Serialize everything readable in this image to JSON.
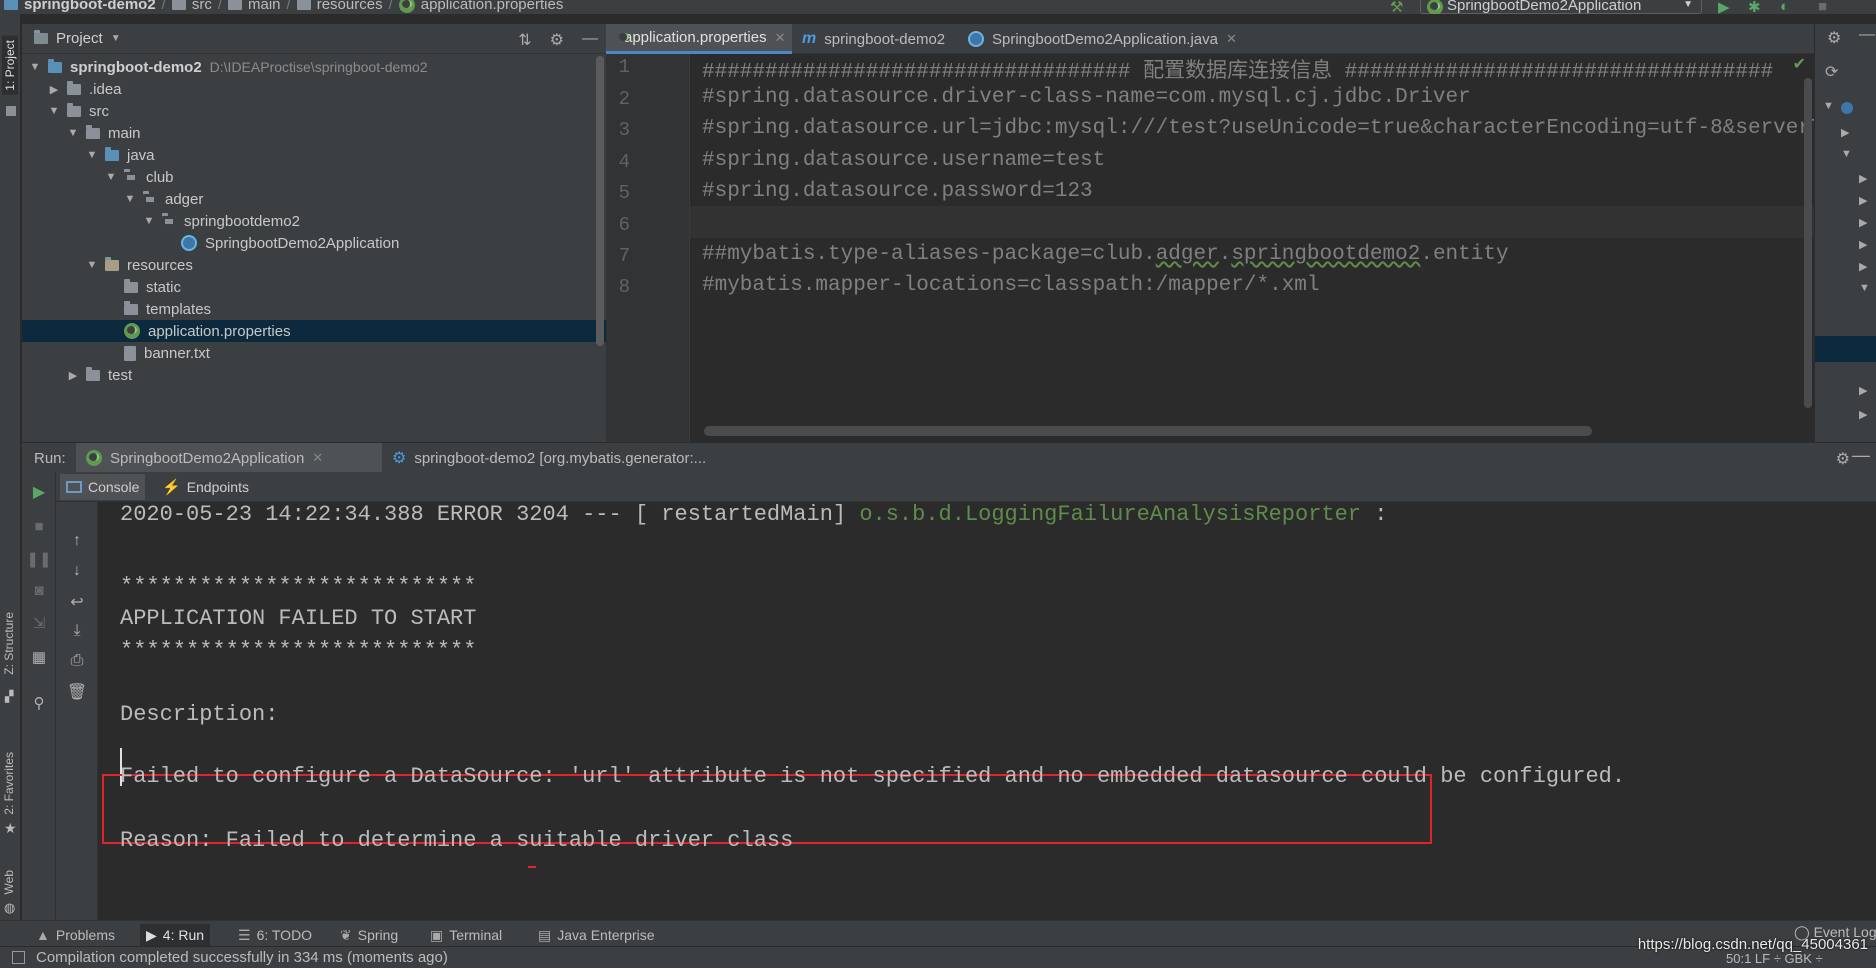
{
  "navbar": {
    "crumbs": [
      "springboot-demo2",
      "src",
      "main",
      "resources",
      "application.properties"
    ],
    "run_config": "SpringbootDemo2Application"
  },
  "left_strip": {
    "project_tab": "1: Project",
    "structure_tab": "Z: Structure",
    "favorites_tab": "2: Favorites",
    "web_tab": "Web"
  },
  "project_panel": {
    "title": "Project",
    "tree": [
      {
        "label": "springboot-demo2",
        "path": "D:\\IDEAProctise\\springboot-demo2",
        "indent": 0,
        "expanded": true,
        "icon": "module-folder-icon"
      },
      {
        "label": ".idea",
        "indent": 1,
        "expanded": false,
        "icon": "folder-icon"
      },
      {
        "label": "src",
        "indent": 1,
        "expanded": true,
        "icon": "folder-icon"
      },
      {
        "label": "main",
        "indent": 2,
        "expanded": true,
        "icon": "folder-icon"
      },
      {
        "label": "java",
        "indent": 3,
        "expanded": true,
        "icon": "source-folder-icon"
      },
      {
        "label": "club",
        "indent": 4,
        "expanded": true,
        "icon": "package-icon"
      },
      {
        "label": "adger",
        "indent": 5,
        "expanded": true,
        "icon": "package-icon"
      },
      {
        "label": "springbootdemo2",
        "indent": 6,
        "expanded": true,
        "icon": "package-icon"
      },
      {
        "label": "SpringbootDemo2Application",
        "indent": 7,
        "icon": "spring-boot-class-icon"
      },
      {
        "label": "resources",
        "indent": 3,
        "expanded": true,
        "icon": "resources-folder-icon"
      },
      {
        "label": "static",
        "indent": 4,
        "icon": "folder-icon"
      },
      {
        "label": "templates",
        "indent": 4,
        "icon": "folder-icon"
      },
      {
        "label": "application.properties",
        "indent": 4,
        "icon": "spring-properties-icon",
        "selected": true
      },
      {
        "label": "banner.txt",
        "indent": 4,
        "icon": "text-file-icon"
      },
      {
        "label": "test",
        "indent": 2,
        "expanded": false,
        "icon": "folder-icon"
      }
    ]
  },
  "editor": {
    "tabs": [
      {
        "label": "application.properties",
        "active": true
      },
      {
        "label": "springboot-demo2",
        "active": false
      },
      {
        "label": "SpringbootDemo2Application.java",
        "active": false
      }
    ],
    "lines": [
      {
        "n": "1",
        "text": "################################## 配置数据库连接信息 ##################################"
      },
      {
        "n": "2",
        "text": "#spring.datasource.driver-class-name=com.mysql.cj.jdbc.Driver"
      },
      {
        "n": "3",
        "text": "#spring.datasource.url=jdbc:mysql:///test?useUnicode=true&characterEncoding=utf-8&serverTimezone=UTC"
      },
      {
        "n": "4",
        "text": "#spring.datasource.username=test"
      },
      {
        "n": "5",
        "text": "#spring.datasource.password=123"
      },
      {
        "n": "6",
        "text": ""
      },
      {
        "n": "7",
        "text_a": "##mybatis.type-aliases-package=club.",
        "text_b": "adger",
        "text_c": ".",
        "text_d": "springbootdemo2",
        "text_e": ".entity"
      },
      {
        "n": "8",
        "text": "#mybatis.mapper-locations=classpath:/mapper/*.xml"
      }
    ]
  },
  "run_panel": {
    "label": "Run:",
    "tabs": [
      {
        "label": "SpringbootDemo2Application",
        "active": true
      },
      {
        "label": "springboot-demo2 [org.mybatis.generator:...",
        "active": false
      }
    ],
    "console_tabs": [
      {
        "label": "Console",
        "active": true
      },
      {
        "label": "Endpoints",
        "active": false
      }
    ],
    "console_lines": {
      "log_prefix": "2020-05-23 14:22:34.388 ERROR 3204 --- [  restartedMain] ",
      "log_logger": "o.s.b.d.LoggingFailureAnalysisReporter",
      "log_suffix": "   :",
      "stars_top": "***************************",
      "headline": "APPLICATION FAILED TO START",
      "stars_bottom": "***************************",
      "description_label": "Description:",
      "error_message": "Failed to configure a DataSource: 'url' attribute is not specified and no embedded datasource could be configured.",
      "reason": "Reason: Failed to determine a suitable driver class"
    }
  },
  "bottom_tools": [
    {
      "label": "Problems",
      "icon": "warning-icon"
    },
    {
      "label": "4: Run",
      "icon": "run-icon",
      "active": true
    },
    {
      "label": "6: TODO",
      "icon": "todo-icon"
    },
    {
      "label": "Spring",
      "icon": "spring-icon"
    },
    {
      "label": "Terminal",
      "icon": "terminal-icon"
    },
    {
      "label": "Java Enterprise",
      "icon": "java-enterprise-icon"
    }
  ],
  "event_log": "Event Log",
  "status": {
    "message": "Compilation completed successfully in 334 ms (moments ago)",
    "position": "50:1   LF ÷   GBK ÷",
    "watermark": "https://blog.csdn.net/qq_45004361"
  },
  "colors": {
    "error_box": "#e0242b",
    "selection": "#0d293e",
    "active_tab_underline": "#4a88c7"
  }
}
